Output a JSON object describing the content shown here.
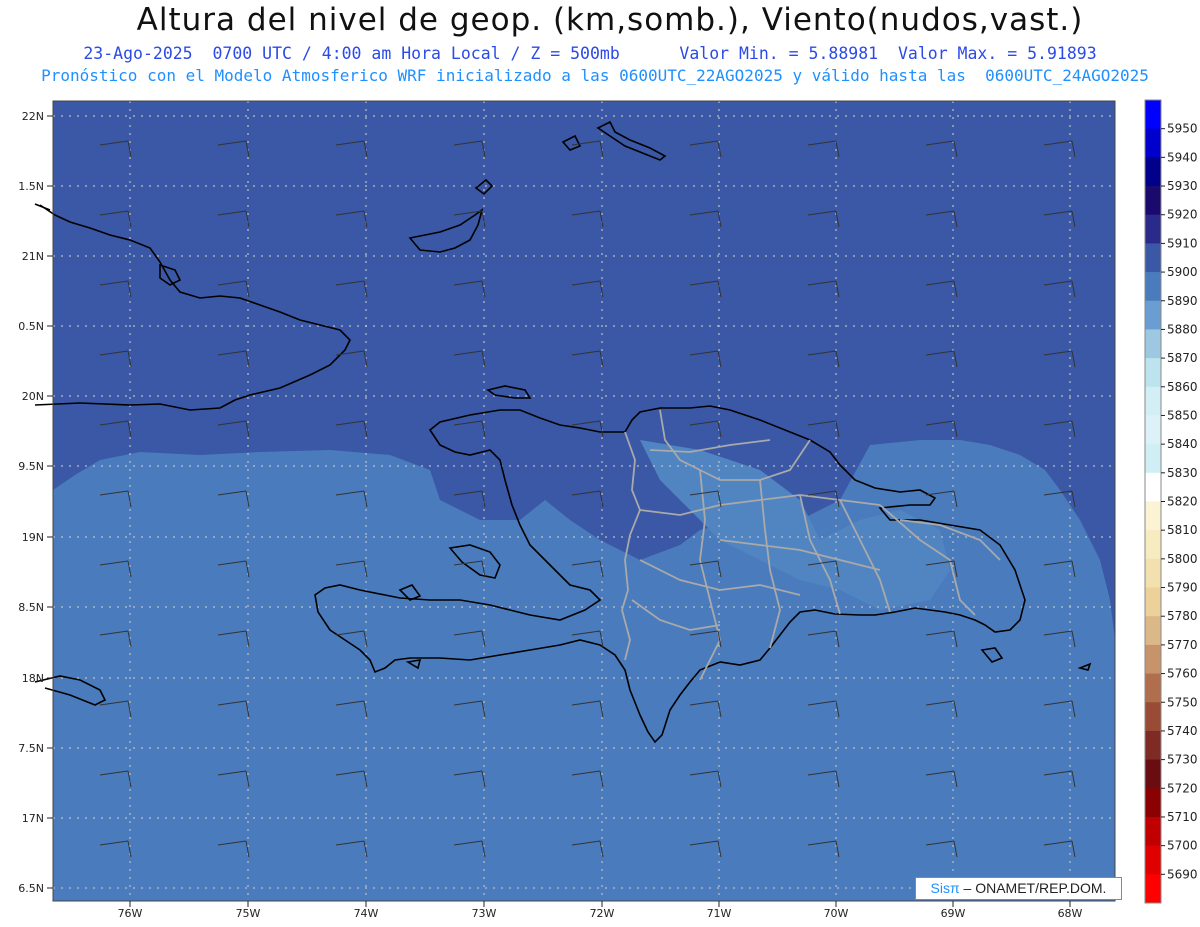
{
  "header": {
    "title": "Altura del nivel de geop. (km,somb.), Viento(nudos,vast.)",
    "date_line": "23-Ago-2025  0700 UTC / 4:00 am Hora Local / Z = 500mb",
    "min_line": "Valor Min. = 5.88981",
    "max_line": "Valor Max. = 5.91893",
    "model_line": "Pronóstico con el Modelo Atmosferico WRF inicializado a las 0600UTC_22AGO2025 y válido hasta las  0600UTC_24AGO2025"
  },
  "map": {
    "lat_labels": [
      "22N",
      "1.5N",
      "21N",
      "0.5N",
      "20N",
      "9.5N",
      "19N",
      "8.5N",
      "18N",
      "7.5N",
      "17N",
      "6.5N"
    ],
    "lon_labels": [
      "76W",
      "75W",
      "74W",
      "73W",
      "72W",
      "71W",
      "70W",
      "69W",
      "68W"
    ],
    "fill_colors": {
      "z5900": "#3a58a6",
      "z5890": "#4a7cbd",
      "z5880": "#5d8fc9"
    }
  },
  "legend": {
    "levels": [
      "5950",
      "5940",
      "5930",
      "5920",
      "5910",
      "5900",
      "5890",
      "5880",
      "5870",
      "5860",
      "5850",
      "5840",
      "5830",
      "5820",
      "5810",
      "5800",
      "5790",
      "5780",
      "5770",
      "5760",
      "5750",
      "5740",
      "5730",
      "5720",
      "5710",
      "5700",
      "5690"
    ],
    "colors": [
      "#0000ff",
      "#0000cc",
      "#00008b",
      "#1a0a6e",
      "#2a2a8a",
      "#3a58a6",
      "#4a7cbd",
      "#6a9ed2",
      "#9ec8e2",
      "#bde3ee",
      "#d3eef5",
      "#dcf2f8",
      "#cfeff5",
      "#ffffff",
      "#fbf3d3",
      "#f7ebc0",
      "#f2e0ae",
      "#ecd19a",
      "#dbb887",
      "#c7936a",
      "#b06e4d",
      "#9a4b35",
      "#7f2a25",
      "#6a0d12",
      "#8b0000",
      "#c00000",
      "#e00000",
      "#ff0000"
    ]
  },
  "credit": {
    "sis": "Sisπ",
    "rest": "– ONAMET/REP.DOM."
  }
}
